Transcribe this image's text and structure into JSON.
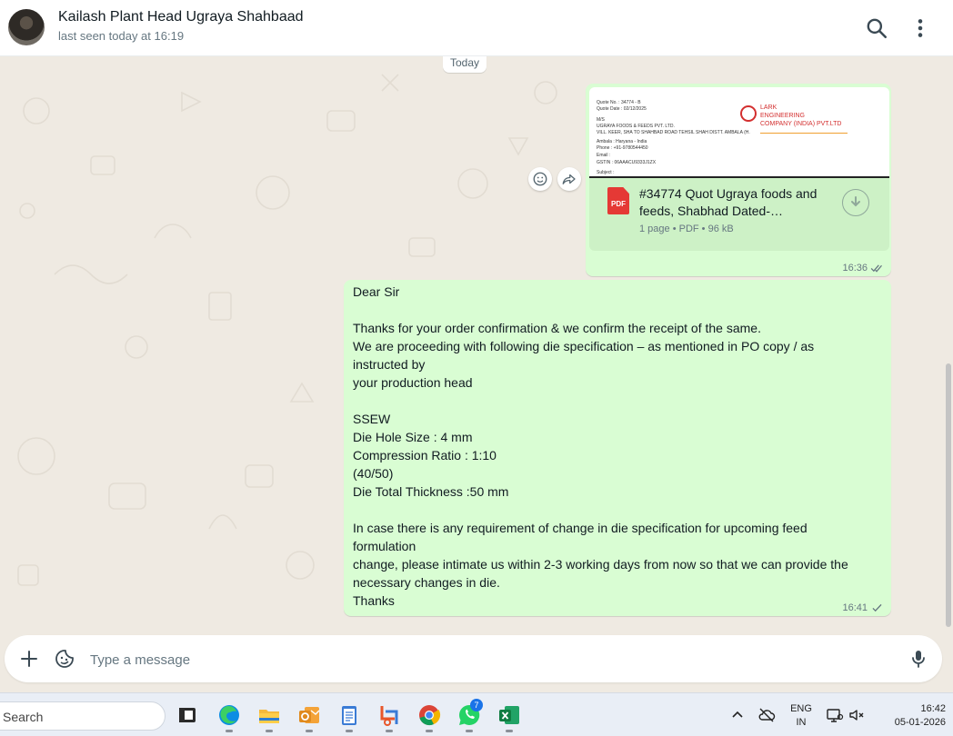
{
  "colors": {
    "outgoing_bubble": "#d9fdd3",
    "chat_background": "#efeae2",
    "pdf_red": "#e53935",
    "accent_blue": "#53bdeb"
  },
  "header": {
    "contact_name": "Kailash Plant Head Ugraya Shahbaad",
    "status": "last seen today at 16:19",
    "icons": [
      "search-icon",
      "menu-icon"
    ]
  },
  "chat": {
    "date_label": "Today",
    "messages": [
      {
        "type": "document",
        "preview_lines": [
          "Quote No. : 34774 - B",
          "Quote Date : 02/12/2025",
          "M/S",
          "UGRAYA FOODS & FEEDS PVT. LTD.",
          "VILL. KEER, SHA TO SHAHBAD ROAD TEHSIL SHAH DISTT. AMBALA (H.",
          "Ambala : Haryana - India",
          "Phone : +91-9780544450",
          "Email :",
          "GSTIN : 06AAACU9333J1ZX",
          "Subject :"
        ],
        "preview_company": [
          "LARK",
          "ENGINEERING",
          "COMPANY (INDIA) PVT.LTD"
        ],
        "title": "#34774 Quot Ugraya foods and feeds, Shabhad Dated-…",
        "meta": "1 page • PDF • 96 kB",
        "time": "16:36",
        "status": "double-tick"
      },
      {
        "type": "text",
        "text": "Dear Sir\n\nThanks for your order confirmation & we confirm the receipt of the same.\nWe are proceeding with following die specification – as mentioned in PO copy / as\ninstructed by\nyour production head\n\nSSEW\nDie Hole Size : 4 mm\nCompression Ratio : 1:10\n(40/50)\nDie Total Thickness :50 mm\n\nIn case there is any requirement of change in die specification for upcoming feed\nformulation\nchange, please intimate us within 2-3 working days from now so that we can provide the\nnecessary changes in die.\nThanks",
        "time": "16:41",
        "status": "single-tick"
      }
    ],
    "floating_actions": [
      "emoji-icon",
      "forward-icon"
    ]
  },
  "composer": {
    "placeholder": "Type a message",
    "icons": [
      "plus-icon",
      "sticker-icon",
      "mic-icon"
    ]
  },
  "taskbar": {
    "search_placeholder": "Search",
    "apps": [
      "task-view",
      "edge",
      "file-explorer",
      "outlook",
      "notepad",
      "snipping-tool",
      "chrome",
      "whatsapp",
      "excel"
    ],
    "whatsapp_badge": "7",
    "lang_line1": "ENG",
    "lang_line2": "IN",
    "time": "16:42",
    "date": "05-01-2026"
  }
}
